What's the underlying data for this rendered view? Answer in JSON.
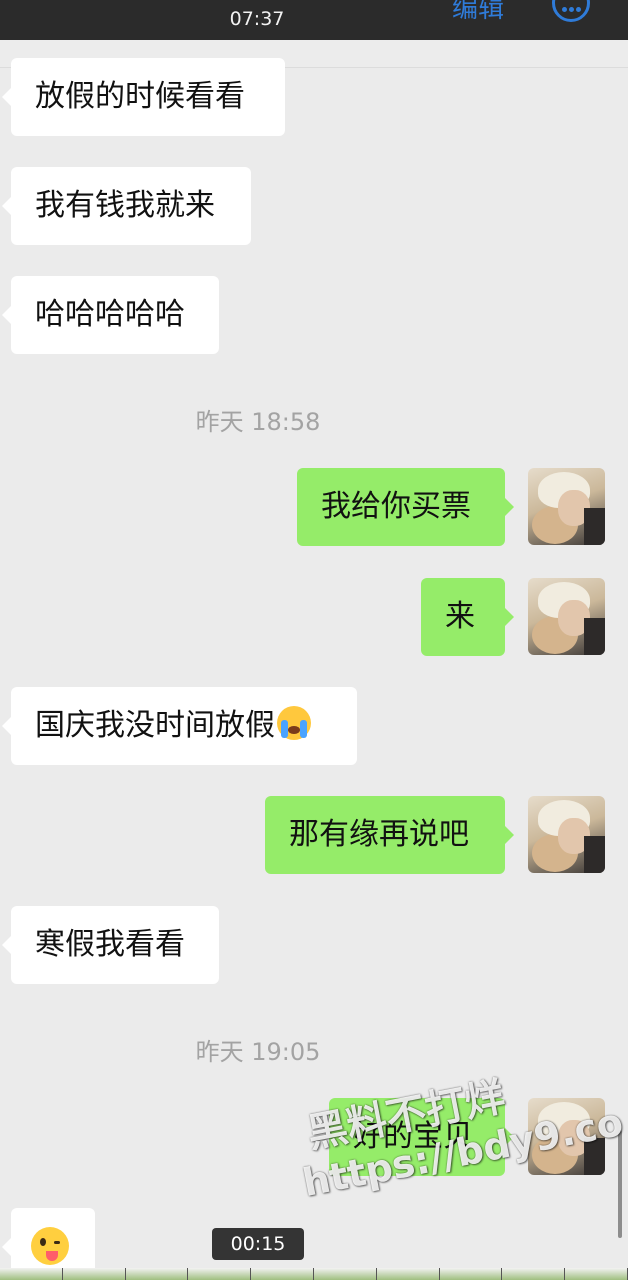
{
  "status_bar": {
    "time": "07:37"
  },
  "nav": {
    "edit_label": "编辑",
    "more_icon": "more-icon"
  },
  "messages": [
    {
      "side": "left",
      "text": "放假的时候看看"
    },
    {
      "side": "left",
      "text": "我有钱我就来"
    },
    {
      "side": "left",
      "text": "哈哈哈哈哈"
    },
    {
      "type": "timestamp",
      "text": "昨天 18:58"
    },
    {
      "side": "right",
      "text": "我给你买票"
    },
    {
      "side": "right",
      "text": "来"
    },
    {
      "side": "left",
      "text": "国庆我没时间放假",
      "emoji": "loudly-crying-face"
    },
    {
      "side": "right",
      "text": "那有缘再说吧"
    },
    {
      "side": "left",
      "text": "寒假我看看"
    },
    {
      "type": "timestamp",
      "text": "昨天 19:05"
    },
    {
      "side": "right",
      "text": "好的宝贝"
    },
    {
      "side": "left",
      "emoji": "winking-face-with-tongue"
    }
  ],
  "watermark": {
    "line1": "黑料不打烊",
    "line2": "https://bdy9.co"
  },
  "video": {
    "timer": "00:15"
  },
  "colors": {
    "self_bubble": "#95ec69",
    "other_bubble": "#ffffff",
    "background": "#ebebeb",
    "accent": "#2f7bd8"
  }
}
